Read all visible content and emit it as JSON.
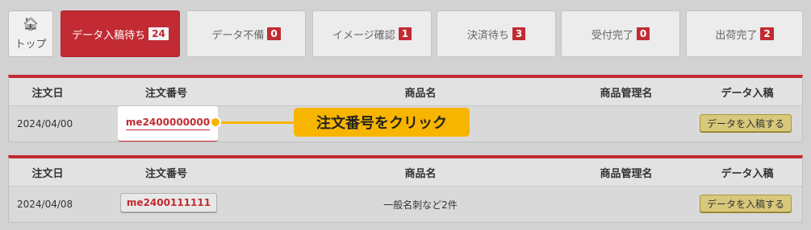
{
  "tabs": {
    "home": {
      "icon": "home-icon",
      "label": "トップ"
    },
    "items": [
      {
        "label": "データ入稿待ち",
        "count": "24",
        "active": true
      },
      {
        "label": "データ不備",
        "count": "0"
      },
      {
        "label": "イメージ確認",
        "count": "1"
      },
      {
        "label": "決済待ち",
        "count": "3"
      },
      {
        "label": "受付完了",
        "count": "0"
      },
      {
        "label": "出荷完了",
        "count": "2"
      }
    ]
  },
  "table1": {
    "headers": {
      "date": "注文日",
      "order": "注文番号",
      "product": "商品名",
      "mgmt": "商品管理名",
      "data": "データ入稿"
    },
    "row": {
      "date": "2024/04/00",
      "order": "me2400000000",
      "product": "",
      "mgmt": "",
      "button": "データを入稿する"
    }
  },
  "table2": {
    "headers": {
      "date": "注文日",
      "order": "注文番号",
      "product": "商品名",
      "mgmt": "商品管理名",
      "data": "データ入稿"
    },
    "row": {
      "date": "2024/04/08",
      "order": "me2400111111",
      "product": "一般名刺など2件",
      "mgmt": "",
      "button": "データを入稿する"
    }
  },
  "callout": {
    "text": "注文番号をクリック"
  },
  "colors": {
    "accent": "#c22b33",
    "callout": "#f7b500",
    "button": "#d8c87a"
  }
}
